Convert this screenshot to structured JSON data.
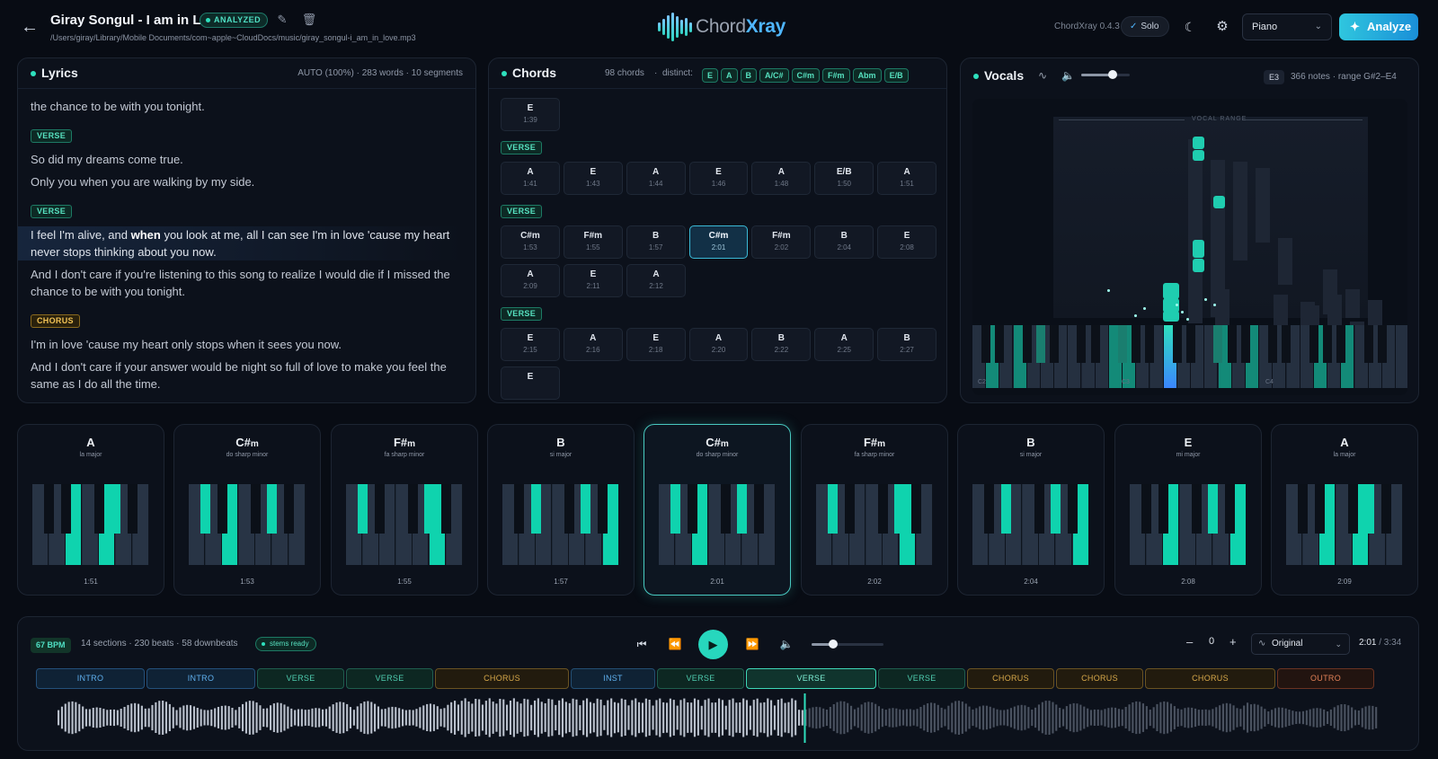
{
  "header": {
    "title": "Giray Songul - I am in Love",
    "status": "ANALYZED",
    "path": "/Users/giray/Library/Mobile Documents/com~apple~CloudDocs/music/giray_songul-i_am_in_love.mp3",
    "logo_a": "Chord",
    "logo_b": "Xray",
    "version": "ChordXray 0.4.3",
    "solo_label": "Solo",
    "instrument": "Piano",
    "analyze_label": "Analyze",
    "icons": {
      "back": "arrow-left-icon",
      "edit": "pencil-icon",
      "delete": "trash-icon",
      "theme": "moon-icon",
      "settings": "gear-icon",
      "analyze": "sparkle-icon"
    }
  },
  "lyrics": {
    "title": "Lyrics",
    "meta": "AUTO (100%)  ·  283 words  ·  10 segments",
    "blocks": [
      {
        "tag": null,
        "lines": [
          {
            "text": "the chance to be with you tonight."
          }
        ]
      },
      {
        "tag": "VERSE",
        "kind": "verse",
        "lines": [
          {
            "text": "So did my dreams come true."
          },
          {
            "text": "Only you when you are walking by my side."
          }
        ]
      },
      {
        "tag": "VERSE",
        "kind": "verse",
        "lines": [
          {
            "pre": "I feel I'm alive, and ",
            "hl": "when",
            "post": " you look at me, all I can see I'm in love 'cause my heart never stops thinking about you now.",
            "active": true
          },
          {
            "text": "And I don't care if you're listening to this song to realize I would die if I missed the chance to be with you tonight."
          }
        ]
      },
      {
        "tag": "CHORUS",
        "kind": "chorus",
        "lines": [
          {
            "text": "I'm in love 'cause my heart only stops when it sees you now."
          },
          {
            "text": "And I don't care if your answer would be night so full of love to make you feel the same as I do all the time."
          }
        ]
      }
    ]
  },
  "chords": {
    "title": "Chords",
    "count": "98 chords",
    "distinct_label": "distinct:",
    "distinct": [
      "E",
      "A",
      "B",
      "A/C#",
      "C#m",
      "F#m",
      "Abm",
      "E/B"
    ],
    "groups": [
      {
        "label": null,
        "rows": [
          [
            {
              "n": "E",
              "t": "1:39"
            }
          ]
        ]
      },
      {
        "label": "VERSE",
        "rows": [
          [
            {
              "n": "A",
              "t": "1:41"
            },
            {
              "n": "E",
              "t": "1:43"
            },
            {
              "n": "A",
              "t": "1:44"
            },
            {
              "n": "E",
              "t": "1:46"
            },
            {
              "n": "A",
              "t": "1:48"
            },
            {
              "n": "E/B",
              "t": "1:50"
            },
            {
              "n": "A",
              "t": "1:51"
            }
          ]
        ]
      },
      {
        "label": "VERSE",
        "rows": [
          [
            {
              "n": "C#m",
              "t": "1:53"
            },
            {
              "n": "F#m",
              "t": "1:55"
            },
            {
              "n": "B",
              "t": "1:57"
            },
            {
              "n": "C#m",
              "t": "2:01",
              "active": true
            },
            {
              "n": "F#m",
              "t": "2:02"
            },
            {
              "n": "B",
              "t": "2:04"
            },
            {
              "n": "E",
              "t": "2:08"
            }
          ],
          [
            {
              "n": "A",
              "t": "2:09"
            },
            {
              "n": "E",
              "t": "2:11"
            },
            {
              "n": "A",
              "t": "2:12"
            }
          ]
        ]
      },
      {
        "label": "VERSE",
        "rows": [
          [
            {
              "n": "E",
              "t": "2:15"
            },
            {
              "n": "A",
              "t": "2:16"
            },
            {
              "n": "E",
              "t": "2:18"
            },
            {
              "n": "A",
              "t": "2:20"
            },
            {
              "n": "B",
              "t": "2:22"
            },
            {
              "n": "A",
              "t": "2:25"
            },
            {
              "n": "B",
              "t": "2:27"
            }
          ],
          [
            {
              "n": "E",
              "t": ""
            }
          ]
        ]
      }
    ]
  },
  "vocals": {
    "title": "Vocals",
    "key": "E3",
    "meta": "366 notes  ·  range G#2–E4",
    "range_label": "VOCAL RANGE",
    "volume_level": 0.65,
    "octave_labels": [
      "C2",
      "C3",
      "C4"
    ],
    "icons": {
      "waveform": "waveform-icon",
      "volume": "speaker-icon"
    }
  },
  "cards": [
    {
      "name": "A",
      "suffix": "",
      "sub": "la major",
      "time": "1:51",
      "white": [
        2,
        4
      ],
      "black": [
        3
      ]
    },
    {
      "name": "C#",
      "suffix": "m",
      "sub": "do sharp minor",
      "time": "1:53",
      "white": [
        2
      ],
      "black": [
        0,
        3
      ]
    },
    {
      "name": "F#",
      "suffix": "m",
      "sub": "fa sharp minor",
      "time": "1:55",
      "white": [
        5
      ],
      "black": [
        0,
        3
      ]
    },
    {
      "name": "B",
      "suffix": "",
      "sub": "si major",
      "time": "1:57",
      "white": [
        6
      ],
      "black": [
        1,
        3
      ]
    },
    {
      "name": "C#",
      "suffix": "m",
      "sub": "do sharp minor",
      "time": "2:01",
      "white": [
        2
      ],
      "black": [
        0,
        3
      ],
      "active": true
    },
    {
      "name": "F#",
      "suffix": "m",
      "sub": "fa sharp minor",
      "time": "2:02",
      "white": [
        5
      ],
      "black": [
        0,
        3
      ]
    },
    {
      "name": "B",
      "suffix": "",
      "sub": "si major",
      "time": "2:04",
      "white": [
        6
      ],
      "black": [
        1,
        3
      ]
    },
    {
      "name": "E",
      "suffix": "",
      "sub": "mi major",
      "time": "2:08",
      "white": [
        2,
        6
      ],
      "black": [
        3
      ]
    },
    {
      "name": "A",
      "suffix": "",
      "sub": "la major",
      "time": "2:09",
      "white": [
        2,
        4
      ],
      "black": [
        3
      ]
    }
  ],
  "transport": {
    "bpm": "67 BPM",
    "meta": "14 sections  ·  230 beats · 58 downbeats",
    "stems": "stems ready",
    "pitch": "0",
    "mix": "Original",
    "time_current": "2:01",
    "time_total": " / 3:34",
    "volume_level": 0.3,
    "progress": 0.565,
    "icons": {
      "prev": "skip-back-icon",
      "rewind": "rewind-icon",
      "play": "play-icon",
      "forward": "fast-forward-icon",
      "volume": "speaker-icon"
    },
    "sections": [
      {
        "label": "INTRO",
        "kind": "intro",
        "w": 123
      },
      {
        "label": "INTRO",
        "kind": "intro",
        "w": 123
      },
      {
        "label": "VERSE",
        "kind": "verse",
        "w": 99
      },
      {
        "label": "VERSE",
        "kind": "verse",
        "w": 99
      },
      {
        "label": "CHORUS",
        "kind": "chorus",
        "w": 151
      },
      {
        "label": "INST",
        "kind": "inst",
        "w": 96
      },
      {
        "label": "VERSE",
        "kind": "verse",
        "w": 99
      },
      {
        "label": "VERSE",
        "kind": "verse",
        "w": 147,
        "active": true
      },
      {
        "label": "VERSE",
        "kind": "verse",
        "w": 99
      },
      {
        "label": "CHORUS",
        "kind": "chorus",
        "w": 99
      },
      {
        "label": "CHORUS",
        "kind": "chorus",
        "w": 99
      },
      {
        "label": "CHORUS",
        "kind": "chorus",
        "w": 147
      },
      {
        "label": "OUTRO",
        "kind": "outro",
        "w": 110
      }
    ]
  }
}
